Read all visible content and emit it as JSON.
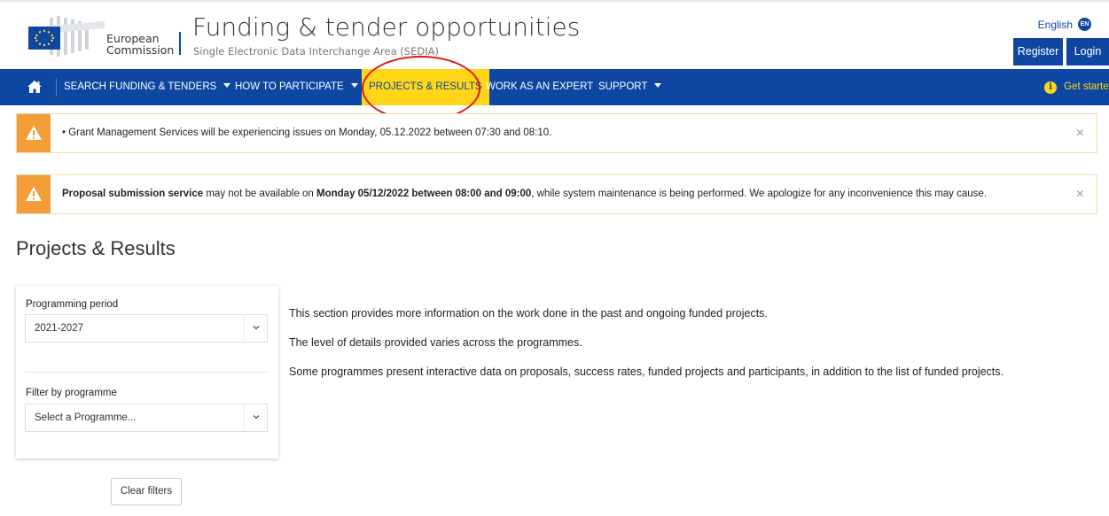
{
  "header": {
    "logo_line1": "European",
    "logo_line2": "Commission",
    "title": "Funding & tender opportunities",
    "subtitle": "Single Electronic Data Interchange Area (SEDIA)",
    "language": "English",
    "language_code": "EN",
    "register_label": "Register",
    "login_label": "Login"
  },
  "nav": {
    "home_icon": "home-icon",
    "items": [
      {
        "label": "SEARCH FUNDING & TENDERS",
        "has_dropdown": true
      },
      {
        "label": "HOW TO PARTICIPATE",
        "has_dropdown": true
      },
      {
        "label": "PROJECTS & RESULTS",
        "active": true
      },
      {
        "label": "WORK AS AN EXPERT"
      },
      {
        "label": "SUPPORT",
        "has_dropdown": true
      }
    ],
    "right_label": "Get started"
  },
  "alerts": [
    {
      "text": "• Grant Management Services will be experiencing issues on Monday, 05.12.2022 between 07:30 and 08:10."
    },
    {
      "bold1": "Proposal submission service",
      "text1": " may not be available on ",
      "bold2": "Monday 05/12/2022 between 08:00 and 09:00",
      "text2": ", while system maintenance is being performed. We apologize for any inconvenience this may cause."
    }
  ],
  "alert_close_glyph": "×",
  "page": {
    "title": "Projects & Results"
  },
  "filters": {
    "period_label": "Programming period",
    "period_value": "2021-2027",
    "programme_label": "Filter by programme",
    "programme_placeholder": "Select a Programme...",
    "clear_label": "Clear filters"
  },
  "intro": [
    "This section provides more information on the work done in the past and ongoing funded projects.",
    "The level of details provided varies across the programmes.",
    "Some programmes present interactive data on proposals, success rates, funded projects and participants, in addition to the list of funded projects."
  ],
  "colors": {
    "brand_blue": "#0e47a1",
    "active_yellow": "#ffd617",
    "warning_orange": "#f29d37",
    "annotation_red": "#e01414"
  }
}
